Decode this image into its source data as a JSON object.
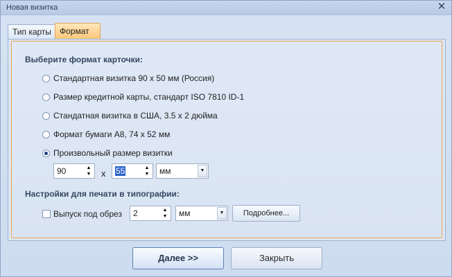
{
  "window": {
    "title": "Новая визитка",
    "close_glyph": "✕"
  },
  "tabs": [
    {
      "label": "Тип карты",
      "active": false
    },
    {
      "label": "Формат",
      "active": true
    }
  ],
  "format": {
    "heading": "Выберите формат карточки:",
    "options": [
      {
        "label": "Стандартная визитка 90 x 50 мм (Россия)",
        "checked": false
      },
      {
        "label": "Размер кредитной карты, стандарт ISO 7810 ID-1",
        "checked": false
      },
      {
        "label": "Стандатная визитка в США, 3.5 x 2 дюйма",
        "checked": false
      },
      {
        "label": "Формат бумаги A8, 74 x 52 мм",
        "checked": false
      },
      {
        "label": "Произвольный размер визитки",
        "checked": true
      }
    ],
    "width_value": "90",
    "height_value": "55",
    "separator": "x",
    "unit": "мм"
  },
  "print": {
    "heading": "Настройки для печати в типографии:",
    "bleed_label": "Выпуск под обрез",
    "bleed_checked": false,
    "bleed_value": "2",
    "bleed_unit": "мм",
    "more_label": "Подробнее..."
  },
  "buttons": {
    "next": "Далее >>",
    "close": "Закрыть"
  },
  "icons": {
    "spin_up": "▲",
    "spin_down": "▼",
    "dropdown": "▼"
  }
}
